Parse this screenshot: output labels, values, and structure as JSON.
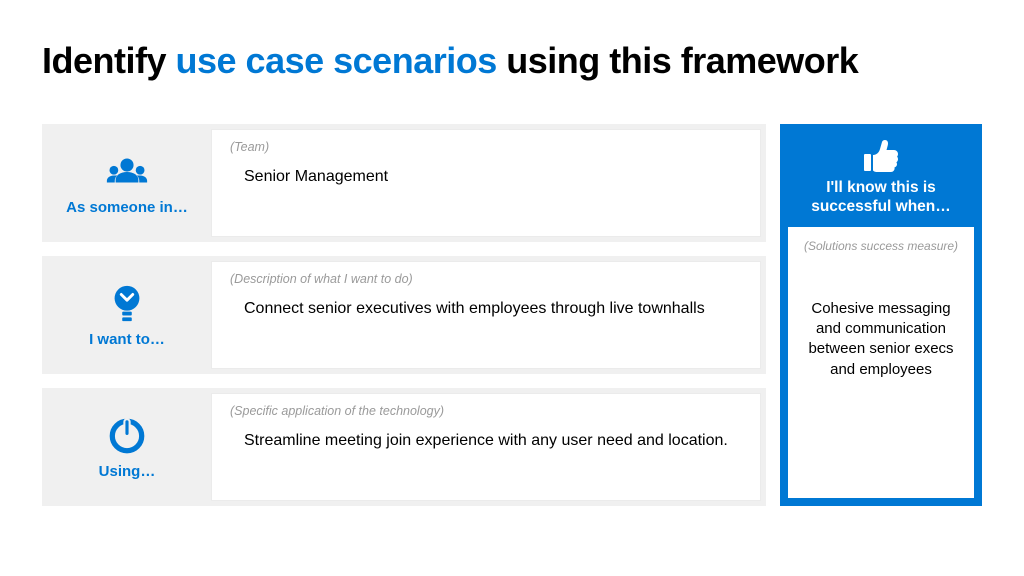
{
  "title": {
    "part1": "Identify ",
    "accent": "use case scenarios",
    "part2": " using this framework"
  },
  "rows": [
    {
      "label": "As someone in…",
      "hint": "(Team)",
      "value": "Senior Management"
    },
    {
      "label": "I want to…",
      "hint": "(Description of what I want to do)",
      "value": "Connect senior executives with employees through live townhalls"
    },
    {
      "label": "Using…",
      "hint": "(Specific application of the technology)",
      "value": "Streamline meeting join experience with any user need and location."
    }
  ],
  "success": {
    "title": "I'll know this is successful when…",
    "hint": "(Solutions success measure)",
    "value": "Cohesive messaging and communication between senior execs and employees"
  }
}
